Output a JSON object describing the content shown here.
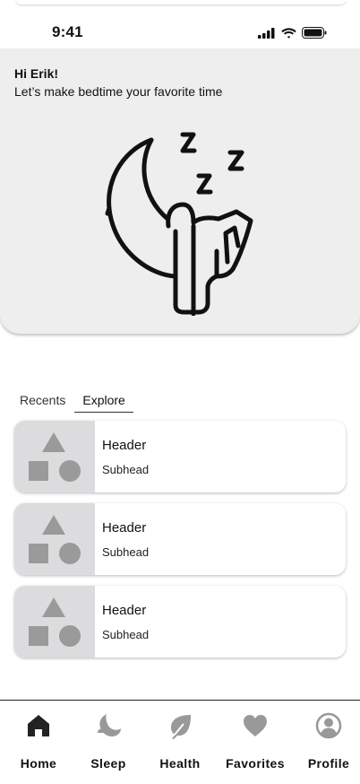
{
  "status_bar": {
    "time": "9:41",
    "signal_icon": "cellular-signal-icon",
    "wifi_icon": "wifi-icon",
    "battery_icon": "battery-icon"
  },
  "hero": {
    "greeting": "Hi Erik!",
    "tagline": "Let’s make bedtime your favorite time",
    "illustration_icon": "sleeping-moon-cat-illustration"
  },
  "tabs": [
    {
      "label": "Recents",
      "selected": false
    },
    {
      "label": "Explore",
      "selected": true
    }
  ],
  "cards": [
    {
      "header": "Header",
      "subhead": "Subhead",
      "thumbnail_icon": "shapes-placeholder-icon"
    },
    {
      "header": "Header",
      "subhead": "Subhead",
      "thumbnail_icon": "shapes-placeholder-icon"
    },
    {
      "header": "Header",
      "subhead": "Subhead",
      "thumbnail_icon": "shapes-placeholder-icon"
    }
  ],
  "bottom_nav": [
    {
      "label": "Home",
      "icon": "home-icon",
      "active": true
    },
    {
      "label": "Sleep",
      "icon": "sleep-icon",
      "active": false
    },
    {
      "label": "Health",
      "icon": "leaf-icon",
      "active": false
    },
    {
      "label": "Favorites",
      "icon": "heart-icon",
      "active": false
    },
    {
      "label": "Profile",
      "icon": "profile-icon",
      "active": false
    }
  ],
  "colors": {
    "active_icon": "#222222",
    "inactive_icon": "#999999",
    "hero_bg": "#eeeeee",
    "thumb_bg": "#dcdcde",
    "placeholder_shape": "#9a9a9a"
  }
}
